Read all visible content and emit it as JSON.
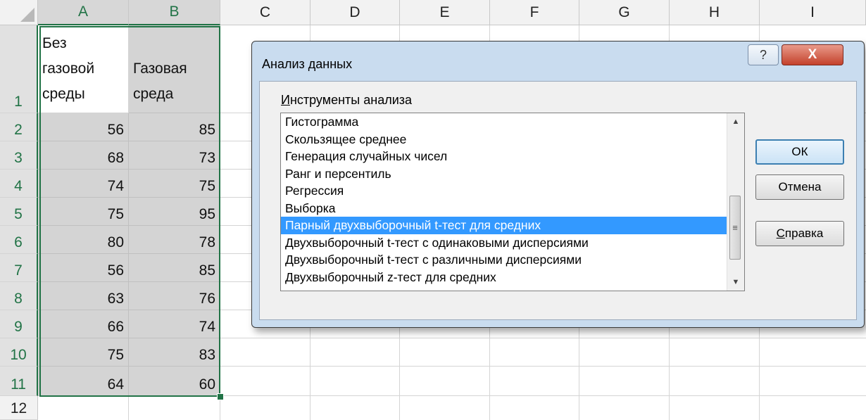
{
  "columns": [
    "A",
    "B",
    "C",
    "D",
    "E",
    "F",
    "G",
    "H",
    "I"
  ],
  "rows": [
    "1",
    "2",
    "3",
    "4",
    "5",
    "6",
    "7",
    "8",
    "9",
    "10",
    "11",
    "12"
  ],
  "header_row": {
    "a1": [
      "Без",
      "газовой",
      "среды"
    ],
    "b1": [
      "Газовая",
      "среда"
    ]
  },
  "data": [
    [
      "56",
      "85"
    ],
    [
      "68",
      "73"
    ],
    [
      "74",
      "75"
    ],
    [
      "75",
      "95"
    ],
    [
      "80",
      "78"
    ],
    [
      "56",
      "85"
    ],
    [
      "63",
      "76"
    ],
    [
      "66",
      "74"
    ],
    [
      "75",
      "83"
    ],
    [
      "64",
      "60"
    ]
  ],
  "dialog": {
    "title": "Анализ данных",
    "help_icon": "?",
    "close_icon": "X",
    "group_label_accel": "И",
    "group_label_rest": "нструменты анализа",
    "tools": [
      "Гистограмма",
      "Скользящее среднее",
      "Генерация случайных чисел",
      "Ранг и персентиль",
      "Регрессия",
      "Выборка",
      "Парный двухвыборочный t-тест для средних",
      "Двухвыборочный t-тест с одинаковыми дисперсиями",
      "Двухвыборочный t-тест с различными дисперсиями",
      "Двухвыборочный z-тест для средних"
    ],
    "selected_index": 6,
    "ok_label": "ОК",
    "cancel_label": "Отмена",
    "help_accel": "С",
    "help_rest": "правка"
  },
  "colors": {
    "selection": "#217346",
    "list_selected": "#3399ff"
  }
}
